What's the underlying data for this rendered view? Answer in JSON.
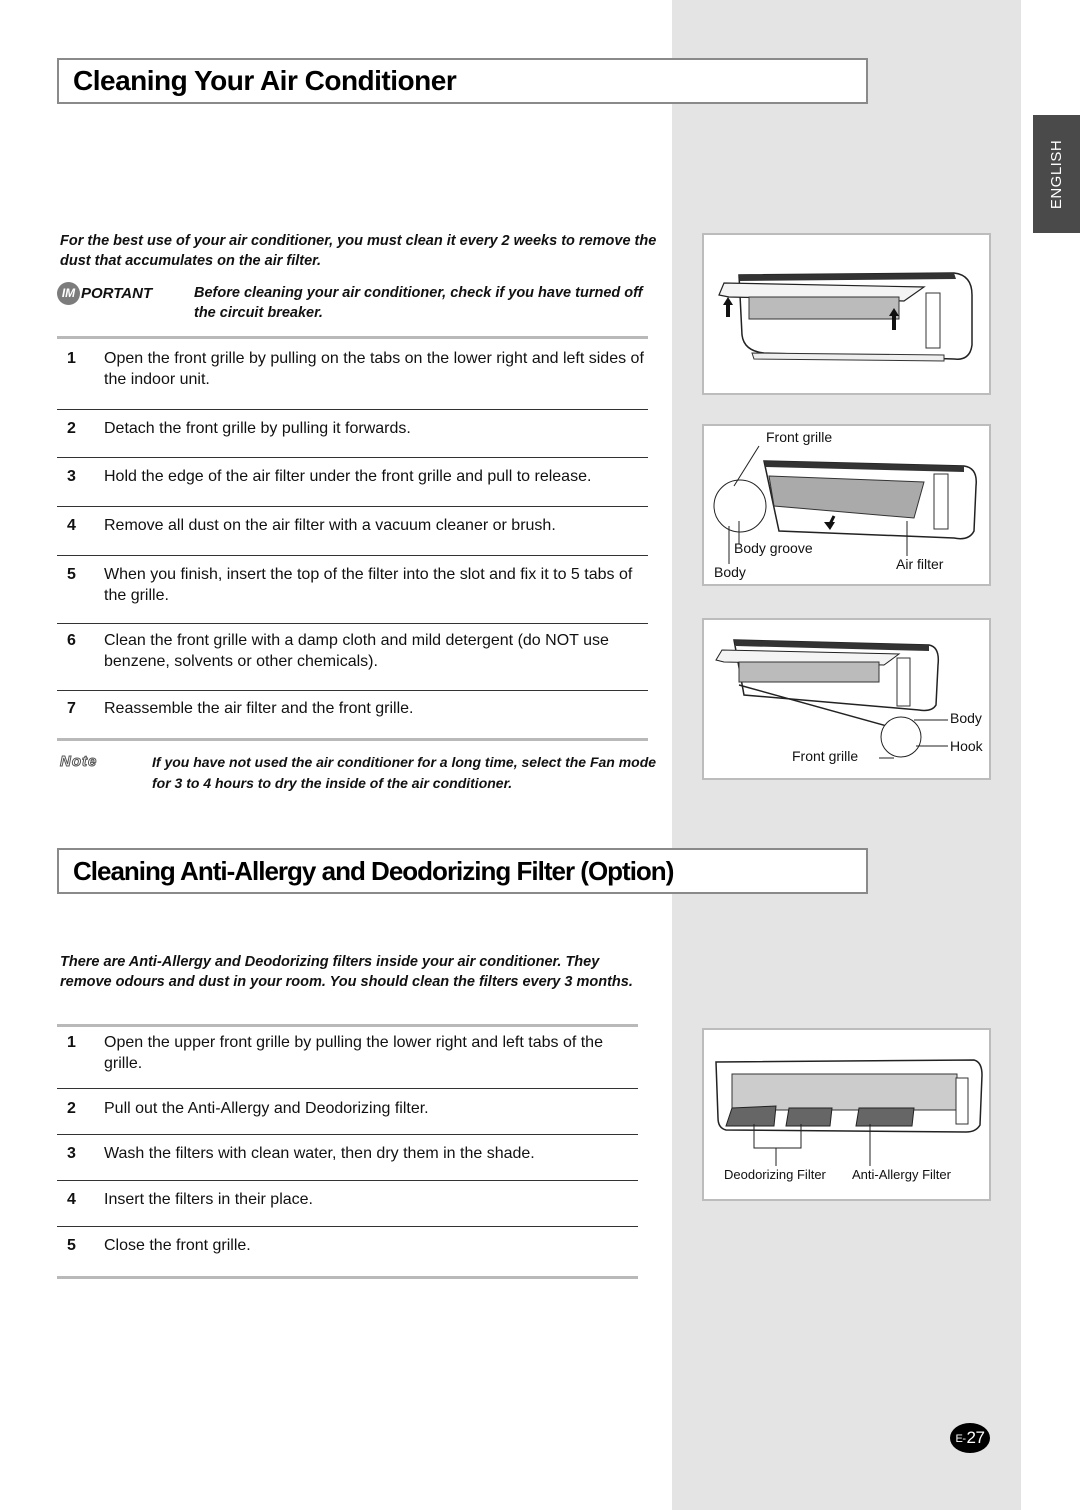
{
  "language_tab": "ENGLISH",
  "section1": {
    "title": "Cleaning Your Air Conditioner",
    "intro": "For the best use of your air conditioner, you must clean it every 2 weeks to remove the dust that accumulates on the air filter.",
    "important": {
      "badge": "IM",
      "label_rest": "PORTANT",
      "text": "Before cleaning your air conditioner, check if you have turned off the circuit breaker."
    },
    "steps": [
      {
        "num": "1",
        "text": "Open the front grille by pulling on the tabs on the lower right and left sides of the indoor unit."
      },
      {
        "num": "2",
        "text": "Detach the front grille by pulling it forwards."
      },
      {
        "num": "3",
        "text": "Hold the edge of the air filter under the front grille and pull to release."
      },
      {
        "num": "4",
        "text": "Remove all dust on the air filter with a vacuum cleaner or brush."
      },
      {
        "num": "5",
        "text": "When you finish, insert the top of the filter into the slot and fix it to 5 tabs of the grille."
      },
      {
        "num": "6",
        "text": "Clean the front grille with a damp cloth and mild detergent (do NOT use benzene, solvents or other chemicals)."
      },
      {
        "num": "7",
        "text": "Reassemble the air filter and the front grille."
      }
    ],
    "note": {
      "label": "Note",
      "text": "If you have not used the air conditioner for a long time, select the Fan mode for 3 to 4 hours to dry the inside of the air conditioner."
    }
  },
  "section2": {
    "title": "Cleaning Anti-Allergy and Deodorizing Filter (Option)",
    "intro": "There are Anti-Allergy and Deodorizing filters inside your air conditioner. They remove odours and dust in your room. You should clean the filters every 3 months.",
    "steps": [
      {
        "num": "1",
        "text": "Open the upper front grille by pulling the lower right and left tabs of the grille."
      },
      {
        "num": "2",
        "text": "Pull out the Anti-Allergy and Deodorizing filter."
      },
      {
        "num": "3",
        "text": "Wash the filters with clean water, then dry them in the shade."
      },
      {
        "num": "4",
        "text": "Insert the filters in their place."
      },
      {
        "num": "5",
        "text": "Close the front grille."
      }
    ]
  },
  "figures": {
    "fig1": {
      "caption": ""
    },
    "fig2": {
      "labels": {
        "front_grille": "Front grille",
        "body_groove": "Body groove",
        "body": "Body",
        "air_filter": "Air filter"
      }
    },
    "fig3": {
      "labels": {
        "body": "Body",
        "hook": "Hook",
        "front_grille": "Front grille"
      }
    },
    "fig4": {
      "labels": {
        "deodorizing": "Deodorizing Filter",
        "anti_allergy": "Anti-Allergy Filter"
      }
    }
  },
  "page_number": {
    "prefix": "E-",
    "number": "27"
  }
}
